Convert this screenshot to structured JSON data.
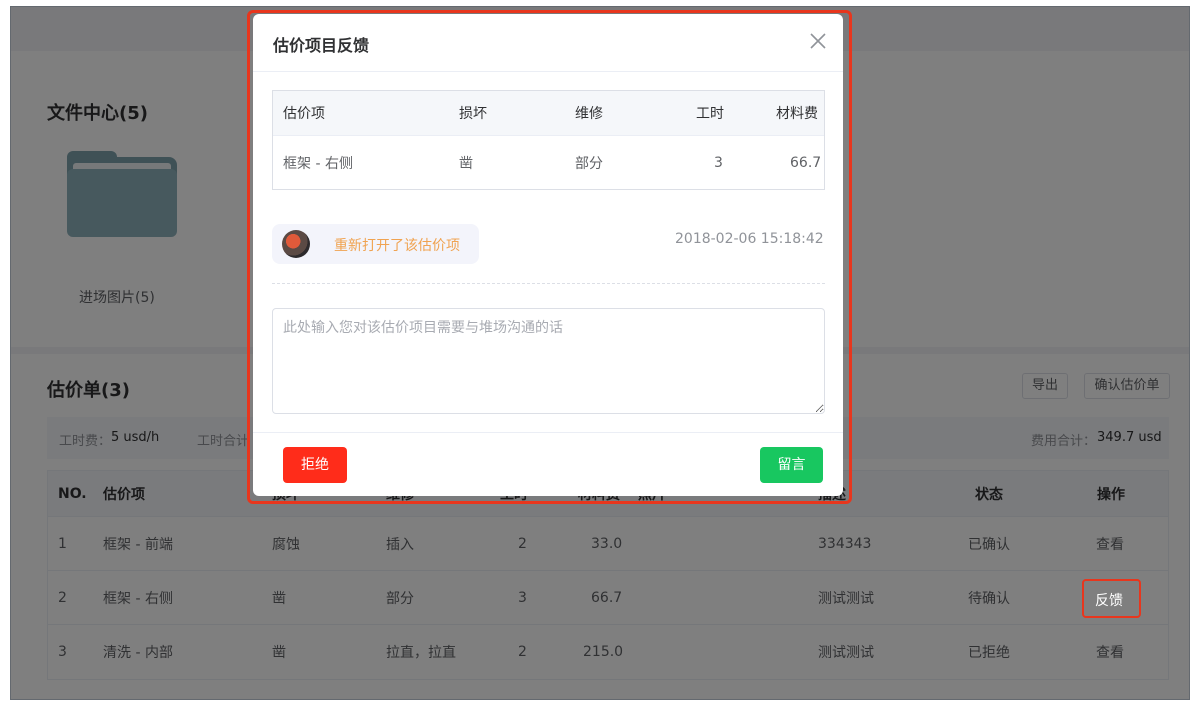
{
  "files": {
    "title": "文件中心(5)",
    "folder_label": "进场图片(5)"
  },
  "estimate": {
    "title": "估价单(3)",
    "export_label": "导出",
    "confirm_label": "确认估价单",
    "labor_rate_label": "工时费：",
    "labor_rate_value": "5 usd/h",
    "labor_total_label": "工时合计",
    "cost_total_label": "费用合计：",
    "cost_total_value": "349.7 usd"
  },
  "table": {
    "headers": {
      "no": "NO.",
      "item": "估价项",
      "damage": "损坏",
      "repair": "维修",
      "hours": "工时",
      "material": "材料费",
      "extra": "照片",
      "desc": "描述",
      "status": "状态",
      "action": "操作"
    },
    "rows": [
      {
        "no": "1",
        "item": "框架 - 前端",
        "damage": "腐蚀",
        "repair": "插入",
        "hours": "2",
        "material": "33.0",
        "desc": "334343",
        "status": "已确认",
        "action": "查看"
      },
      {
        "no": "2",
        "item": "框架 - 右侧",
        "damage": "凿",
        "repair": "部分",
        "hours": "3",
        "material": "66.7",
        "desc": "测试测试",
        "status": "待确认",
        "action": "反馈"
      },
      {
        "no": "3",
        "item": "清洗 - 内部",
        "damage": "凿",
        "repair": "拉直，拉直",
        "hours": "2",
        "material": "215.0",
        "desc": "测试测试",
        "status": "已拒绝",
        "action": "查看"
      }
    ]
  },
  "dialog": {
    "title": "估价项目反馈",
    "close_icon": "close-icon",
    "table": {
      "headers": {
        "item": "估价项",
        "damage": "损坏",
        "repair": "维修",
        "hours": "工时",
        "material": "材料费"
      },
      "row": {
        "item": "框架 - 右侧",
        "damage": "凿",
        "repair": "部分",
        "hours": "3",
        "material": "66.7"
      }
    },
    "message": {
      "text": "重新打开了该估价项",
      "time": "2018-02-06 15:18:42"
    },
    "textarea_placeholder": "此处输入您对该估价项目需要与堆场沟通的话",
    "reject_label": "拒绝",
    "comment_label": "留言"
  },
  "colors": {
    "highlight": "#e8361d",
    "reject": "#ff2c1a",
    "comment": "#18c760",
    "message_text": "#f0a351"
  }
}
